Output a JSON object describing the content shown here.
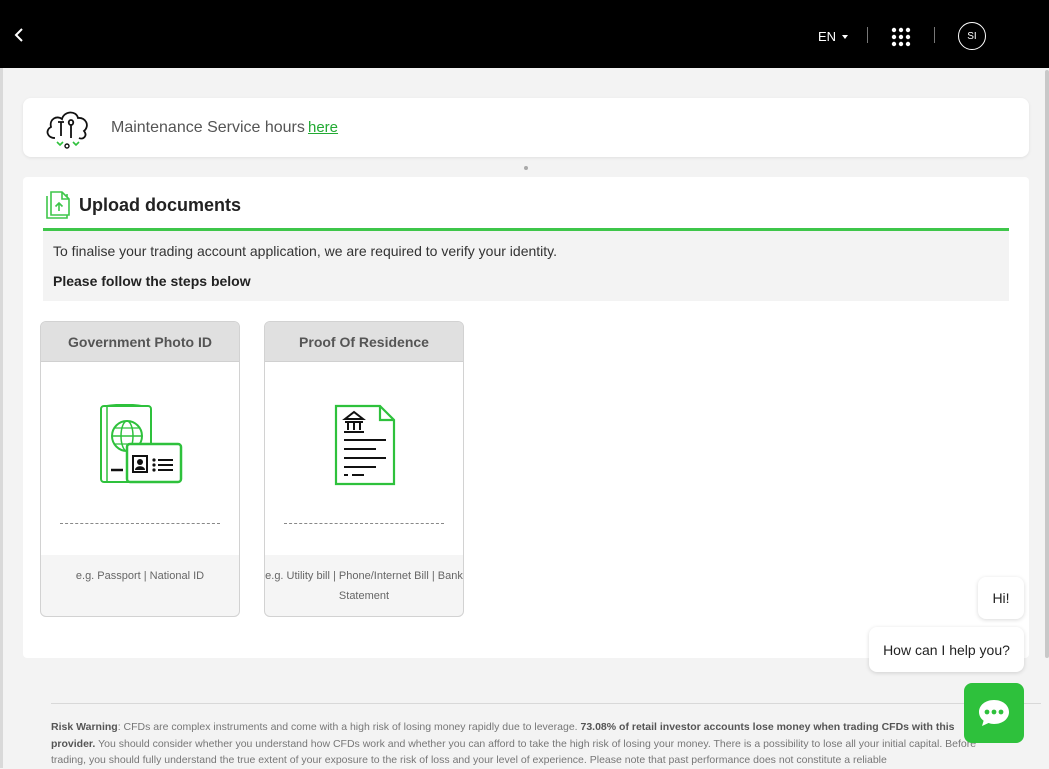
{
  "header": {
    "language": "EN",
    "user_initials": "SI"
  },
  "maintenance": {
    "text": "Maintenance Service hours",
    "link": "here"
  },
  "upload": {
    "title": "Upload documents",
    "intro": "To finalise your trading account application, we are required to verify your identity.",
    "steps": "Please follow the steps below",
    "documents": [
      {
        "title": "Government Photo ID",
        "hint": "e.g. Passport | National ID",
        "icon": "id-card-icon"
      },
      {
        "title": "Proof Of Residence",
        "hint": "e.g. Utility bill | Phone/Internet Bill | Bank Statement",
        "icon": "bill-document-icon"
      }
    ]
  },
  "risk": {
    "label": "Risk Warning",
    "text1": ": CFDs are complex instruments and come with a high risk of losing money rapidly due to leverage. ",
    "bold": "73.08% of retail investor accounts lose money when trading CFDs with this provider.",
    "text2": " You should consider whether you understand how CFDs work and whether you can afford to take the high risk of losing your money. There is a possibility to lose all your initial capital. Before trading, you should fully understand the true extent of your exposure to the risk of loss and your level of experience. Please note that past performance does not constitute a reliable"
  },
  "chat": {
    "greeting": "Hi!",
    "prompt": "How can I help you?"
  },
  "colors": {
    "accent": "#3ec64a",
    "topbar": "#000000"
  }
}
